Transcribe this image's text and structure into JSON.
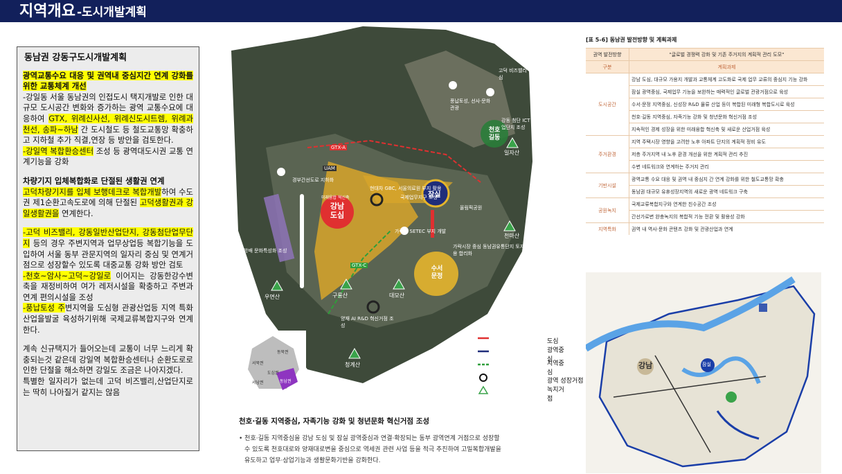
{
  "header": {
    "title": "지역개요",
    "subtitle": "-도시개발계획"
  },
  "panel": {
    "title": "동남권 강동구도시개발계획",
    "p1_head": "광역교통수요 대응 및 권역내 중심지간 연계 강화를 위한 교통체계 개선",
    "p1_a": "-강일동 서울 동남권의 인접도시 택지개발로 인한 대규모 도시공간 변화와 증가하는 광역 교통수요에 대응하여 ",
    "p1_hl1": "GTX, 위례신사선, 위례신도시트렘, 위례과천선, 송파~하남",
    "p1_b": " 간 도시철도 등 철도교통망 확충하고 지하철 추가 직결,연장 등 방안을 검토한다.",
    "p1_hl2": "-강일역 복합환승센터",
    "p1_c": " 조성 등 광역대도시권 교통 연계기능을 강화",
    "p2_head": "차량기지 입체복합화로 단절된 생활권 연계",
    "p2_hl1": " 고덕차량기지를 입체 보행데크로 복합개발",
    "p2_a": "하여 수도권 제1순환고속도로에 의해 단절된 ",
    "p2_hl2": "고덕생활권과 강일생활권을",
    "p2_b": " 연계한다.",
    "p3_hl1": "-고덕 비즈밸리, 강동일반산업단지, 강동첨단업무단지",
    "p3_a": " 등의 경우 주변지역과 업무상업등 복합기능을 도입하여 서울 동부 관문지역의 일자리 중심 및 연계거점으로 성장할수 있도록 대중교통 강화 방안 검토",
    "p3_hl2": "-천호~암사~고덕~강일로",
    "p3_b": " 이어지는 강동한강수변축을 재정비하여 여가 레저시설을 확충하고 주변과연계 편의시설을 조성",
    "p3_hl3": "-풍납토성 주",
    "p3_c": "변지역을 도심형 관광산업등 지역 특화 산업을발굴 육성하기위해 국제교류복합지구와 연계한다.",
    "p4": "계속 신규택지가 들어오는데 교통이 너무 느리게 확충되는것 같은데 강일역 복합환승센터나 순환도로로 인한 단절을 해소하면 강일도 조금은 나아지겠다.",
    "p5": "특별한 일자리가 없는데 고덕 비즈밸리,산업단지로는 딱히 나아질거 같지는 않음"
  },
  "map": {
    "labels": {
      "gangnam": "강남\n도심",
      "jamsil": "잠실",
      "cheonho": "천호\n길동",
      "suseo": "수서\n문정",
      "gtxa": "GTX-A",
      "gtxc": "GTX-C",
      "uam": "UAM",
      "l1": "고덕 비즈밸리 중심",
      "l2": "풍납토성, 선사·문화 관광",
      "l3": "강동 첨단 ICT 산업단지 조성",
      "l4": "현대차 GBC, 서울의료원 부지 활용",
      "l5": "국제업무지구 조성",
      "l6": "올림픽공원",
      "l7": "경부간선도로 지하화",
      "l8": "미래융합 혁신축",
      "l9": "방배 문화특성화 조성",
      "l10": "가락시장 중심 동남권유통단지 토지이용 합리화",
      "l11": "가락동 SETEC 부지 개발",
      "l12": "양재 AI R&D 혁신거점 조성",
      "l13": "우면산",
      "l14": "구룡산",
      "l15": "대모산",
      "l16": "청계산",
      "l17": "일자산",
      "l18": "천마산",
      "l19": "수서"
    },
    "legend": [
      {
        "label": "도심",
        "color": "#e03030"
      },
      {
        "label": "광역중심",
        "color": "#1f2d7a"
      },
      {
        "label": "지역중심",
        "color": "#2e9e3a"
      },
      {
        "label": "광역 성장거점",
        "color": "#111111"
      },
      {
        "label": "녹지거점",
        "color": "#3aa34a"
      }
    ],
    "inset": {
      "labels": [
        "동북권",
        "서북권",
        "도심권",
        "서남권",
        "동남권"
      ]
    }
  },
  "caption": {
    "title": "천호·길동 지역중심, 자족기능 강화 및 청년문화 혁신거점 조성",
    "line1": "• 천호·길동 지역중심을 강남 도심 및 잠실 광역중심과 연결·확장되는 동부 광역연계 거점으로 성장할",
    "line2": "수 있도록 천호대로와 양재대로변을 중심으로 역세권 관련 사업 등을 적극 추진하여 고밀복합개발을",
    "line3": "유도하고 업무·상업기능과 생활문화기반을 강화한다."
  },
  "table": {
    "title": "[표 5-6] 동남권 발전방향 및 계획과제",
    "col1": "권역 발전방향",
    "col1v": "\"글로벌 경쟁력 강화 및 기존 주거지의 계획적 관리 도모\"",
    "col2": "구분",
    "col2v": "계획과제",
    "rows": [
      {
        "cat": "도시공간",
        "items": [
          "강남 도심, 대규모 가용지 개발과 교통체계 고도화로 국제 업무 교류의 중심지 기능 강화",
          "잠실 광역중심, 국제업무 기능을 보완하는 매력적인 글로벌 관광거점으로 육성",
          "수서·문정 지역중심, 신성장 R&D 물류 산업 등이 복합된 미래형 복합도시로 육성",
          "천호·길동 지역중심, 자족기능 강화 및 청년문화 혁신거점 조성",
          "지속적인 경제 성장을 위한 미래융합 혁신축 및 새로운 산업거점 육성"
        ]
      },
      {
        "cat": "주거환경",
        "items": [
          "지역 주택시장 영향을 고려한 노후 아파트 단지의 계획적 정비 유도",
          "저층 주거지역 내 노후 환경 개선을 위한 계획적 관리 추진",
          "수변 네트워크와 연계하는 주거지 관리"
        ]
      },
      {
        "cat": "기반시설",
        "items": [
          "광역교통 수요 대응 및 권역 내 중심지 간 연계 강화를 위한 철도교통망 확충",
          "동남권 대규모 유휴성장지역의 새로운 광역 네트워크 구축"
        ]
      },
      {
        "cat": "공원녹지",
        "items": [
          "국제교류복합지구와 연계한 친수공간 조성",
          "간선가로변 완충녹지의 복합적 기능 전환 및 활용성 강화"
        ]
      },
      {
        "cat": "지역특화",
        "items": [
          "권역 내 역사·문화 콘텐츠 강화 및 관광산업과 연계"
        ]
      }
    ]
  },
  "smap": {
    "labels": [
      "강남",
      "잠실"
    ]
  }
}
